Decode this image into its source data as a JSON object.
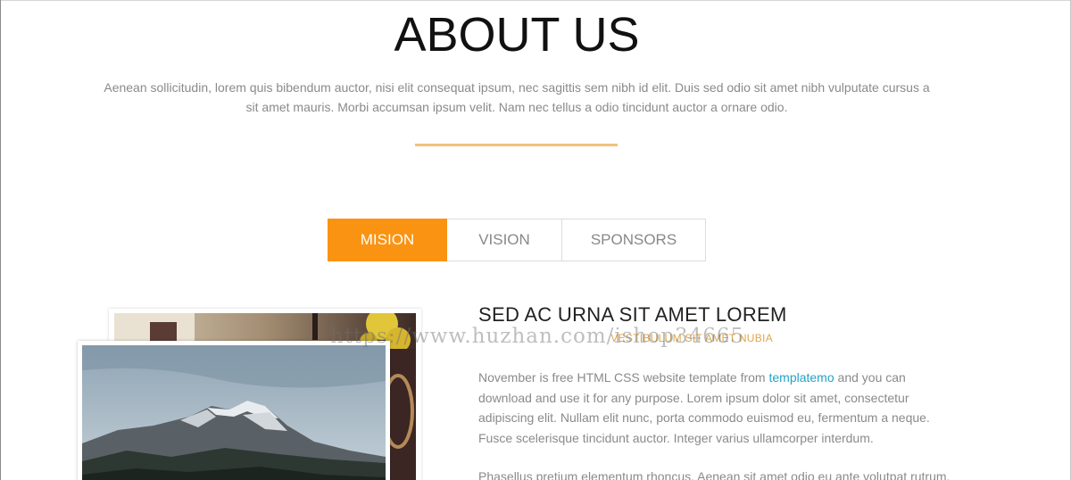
{
  "page": {
    "title": "ABOUT US",
    "intro": "Aenean sollicitudin, lorem quis bibendum auctor, nisi elit consequat ipsum, nec sagittis sem nibh id elit. Duis sed odio sit amet nibh vulputate cursus a sit amet mauris. Morbi accumsan ipsum velit. Nam nec tellus a odio tincidunt auctor a ornare odio."
  },
  "tabs": [
    {
      "label": "MISION",
      "active": true
    },
    {
      "label": "VISION",
      "active": false
    },
    {
      "label": "SPONSORS",
      "active": false
    }
  ],
  "content": {
    "title": "SED AC URNA SIT AMET LOREM",
    "subtitle": "VESTIBULUM SIT AMET NUBIA",
    "para1_before": "November is free HTML CSS website template from ",
    "para1_link": "templatemo",
    "para1_after": " and you can download and use it for any purpose. Lorem ipsum dolor sit amet, consectetur adipiscing elit. Nullam elit nunc, porta commodo euismod eu, fermentum a neque. Fusce scelerisque tincidunt auctor. Integer varius ullamcorper interdum.",
    "para2": "Phasellus pretium elementum rhoncus. Aenean sit amet odio eu ante volutpat rutrum."
  },
  "watermark": "https://www.huzhan.com/ishop34665",
  "colors": {
    "accent": "#fa9312",
    "divider": "#f0c27b",
    "link": "#21a3c8",
    "subtitle": "#e0a64a"
  },
  "icons": {
    "photo_back": "pot-and-flowers-photo",
    "photo_front": "mountain-photo"
  }
}
